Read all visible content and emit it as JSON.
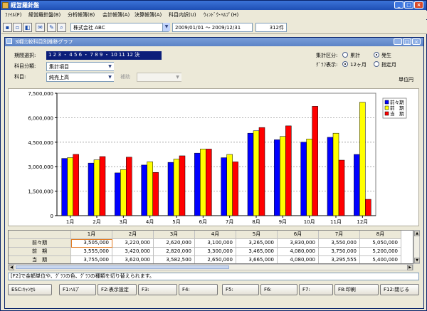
{
  "app": {
    "title": "経営羅針盤"
  },
  "menu": [
    "ﾌｧｲﾙ(F)",
    "経営羅針盤(B)",
    "分析帳簿(B)",
    "会計帳簿(A)",
    "決算帳簿(A)",
    "科目内訳(U)",
    "ｳｨﾝﾄﾞｳ･ﾍﾙﾌﾟ(H)"
  ],
  "toolbar": {
    "company": "株式会社 ABC",
    "date_range": "2009/01/01 ～ 2009/12/31",
    "count": "312件"
  },
  "subwindow": {
    "title": "3期比較科目別推移グラフ"
  },
  "controls": {
    "period_label": "期間選択:",
    "period_value": "1 2 3 ・ 4 5 6 ・ 7 8 9 ・ 10 11 12 決",
    "category_label": "科目分類:",
    "category_value": "集計項目",
    "account_label": "科目:",
    "account_value": "純売上高",
    "aux_label": "補助",
    "aux_value": "",
    "agg_label": "集計区分:",
    "agg_opt1": "累計",
    "agg_opt2": "発生",
    "graph_label": "ｸﾞﾗﾌ表示:",
    "graph_opt1": "12ヶ月",
    "graph_opt2": "指定月",
    "unit": "単位円"
  },
  "chart_data": {
    "type": "bar",
    "categories": [
      "1月",
      "2月",
      "3月",
      "4月",
      "5月",
      "6月",
      "7月",
      "8月",
      "9月",
      "10月",
      "11月",
      "12月"
    ],
    "ylim": [
      0,
      7500000
    ],
    "yticks": [
      "0",
      "1,500,000",
      "3,000,000",
      "4,500,000",
      "6,000,000",
      "7,500,000"
    ],
    "grid": true,
    "legend_position": "top-right",
    "series": [
      {
        "name": "前々期",
        "color": "#0000ff",
        "values": [
          3505000,
          3220000,
          2620000,
          3100000,
          3265000,
          3830000,
          3550000,
          5050000,
          4650000,
          4500000,
          4800000,
          3750000
        ]
      },
      {
        "name": "前　期",
        "color": "#ffff00",
        "values": [
          3555000,
          3420000,
          2820000,
          3300000,
          3465000,
          4080000,
          3750000,
          5200000,
          4850000,
          4700000,
          5050000,
          6950000
        ]
      },
      {
        "name": "当　期",
        "color": "#ff0000",
        "values": [
          3755000,
          3620000,
          3582500,
          2650000,
          3665000,
          4080000,
          3295555,
          5400000,
          5500000,
          6700000,
          3400000,
          1000000
        ]
      }
    ]
  },
  "table": {
    "columns": [
      "1月",
      "2月",
      "3月",
      "4月",
      "5月",
      "6月",
      "7月",
      "8月"
    ],
    "rows": [
      {
        "label": "前々期",
        "values": [
          "3,505,000",
          "3,220,000",
          "2,620,000",
          "3,100,000",
          "3,265,000",
          "3,830,000",
          "3,550,000",
          "5,050,000"
        ]
      },
      {
        "label": "前　期",
        "values": [
          "3,555,000",
          "3,420,000",
          "2,820,000",
          "3,300,000",
          "3,465,000",
          "4,080,000",
          "3,750,000",
          "5,200,000"
        ]
      },
      {
        "label": "当　期",
        "values": [
          "3,755,000",
          "3,620,000",
          "3,582,500",
          "2,650,000",
          "3,665,000",
          "4,080,000",
          "3,295,555",
          "5,400,000"
        ]
      }
    ]
  },
  "status": "[F2]で金額単位や、ｸﾞﾗﾌの色、ｸﾞﾗﾌの種類を切り替えられます。",
  "fkeys": [
    "ESC:ｷｬﾝｾﾙ",
    "F1:ﾍﾙﾌﾟ",
    "F2:表示設定",
    "F3:",
    "F4:",
    "F5:",
    "F6:",
    "F7:",
    "F8:印刷",
    "F12:閉じる"
  ]
}
